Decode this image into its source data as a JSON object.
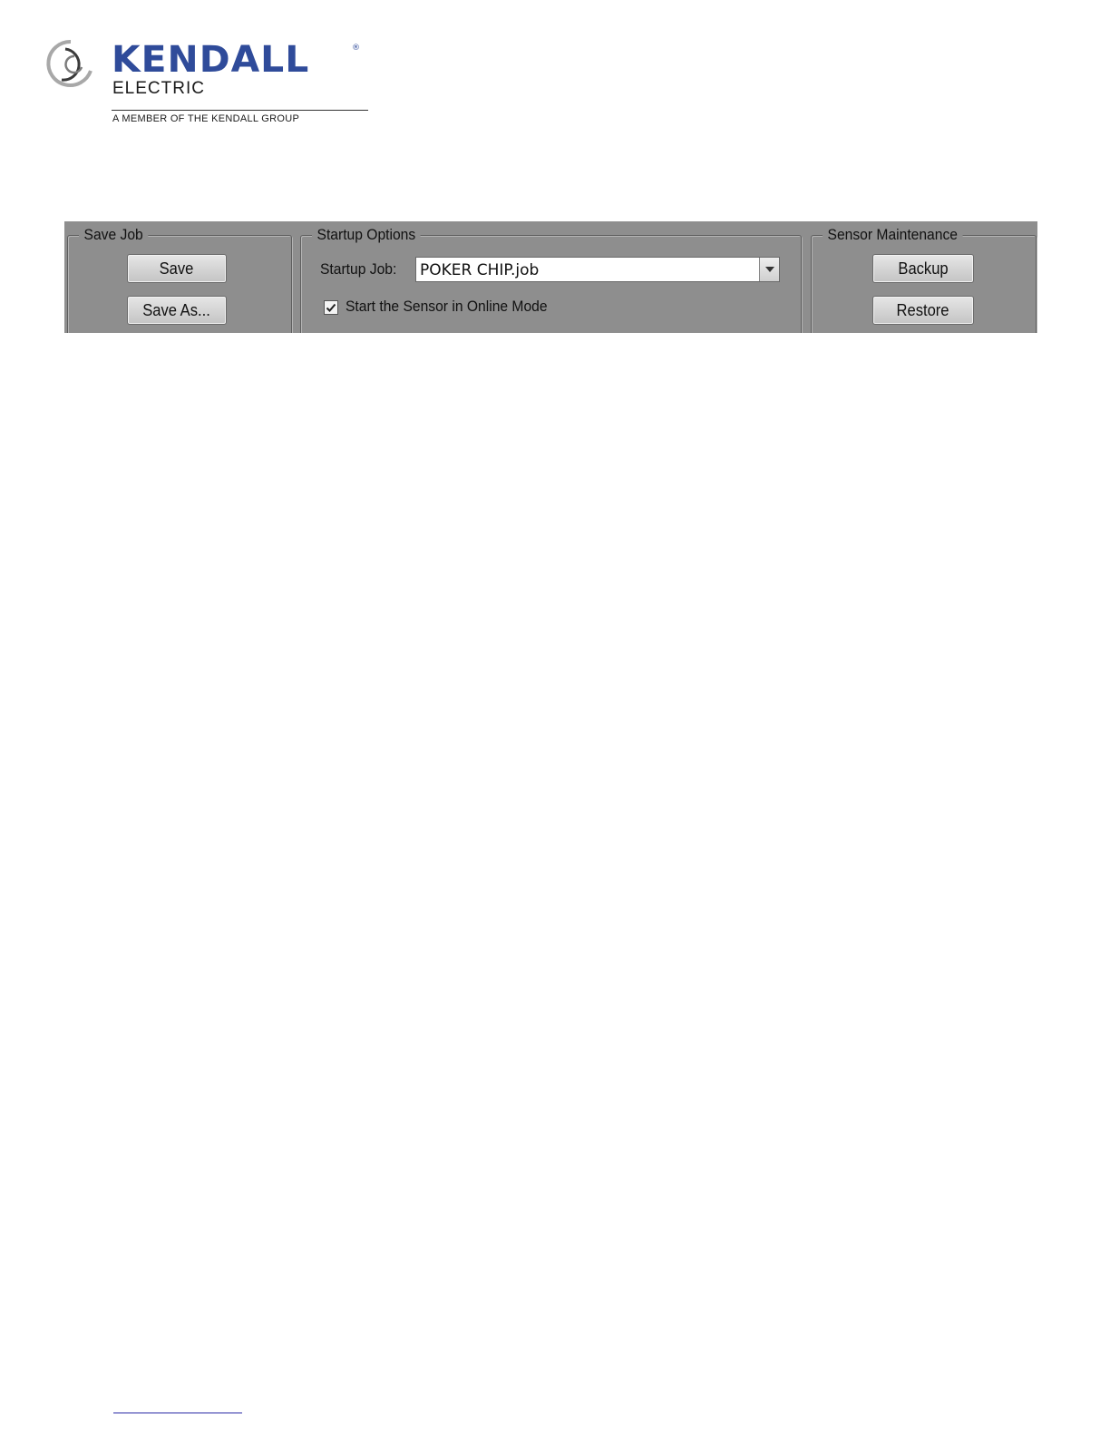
{
  "logo": {
    "name": "KENDALL",
    "registered": "®",
    "sub": "ELECTRIC",
    "tagline": "A MEMBER OF THE KENDALL GROUP"
  },
  "save_job": {
    "title": "Save Job",
    "save_label": "Save",
    "save_as_label": "Save As..."
  },
  "startup_options": {
    "title": "Startup Options",
    "startup_job_label": "Startup Job:",
    "startup_job_value": "POKER CHIP.job",
    "online_mode_label": "Start the Sensor in Online Mode",
    "online_mode_checked": true
  },
  "sensor_maintenance": {
    "title": "Sensor Maintenance",
    "backup_label": "Backup",
    "restore_label": "Restore"
  },
  "colors": {
    "brand_blue": "#2f4b9a",
    "panel_gray": "#8e8e8e"
  },
  "icons": [
    "kendall-swirl-logo-icon",
    "chevron-down-icon",
    "checkmark-icon"
  ]
}
